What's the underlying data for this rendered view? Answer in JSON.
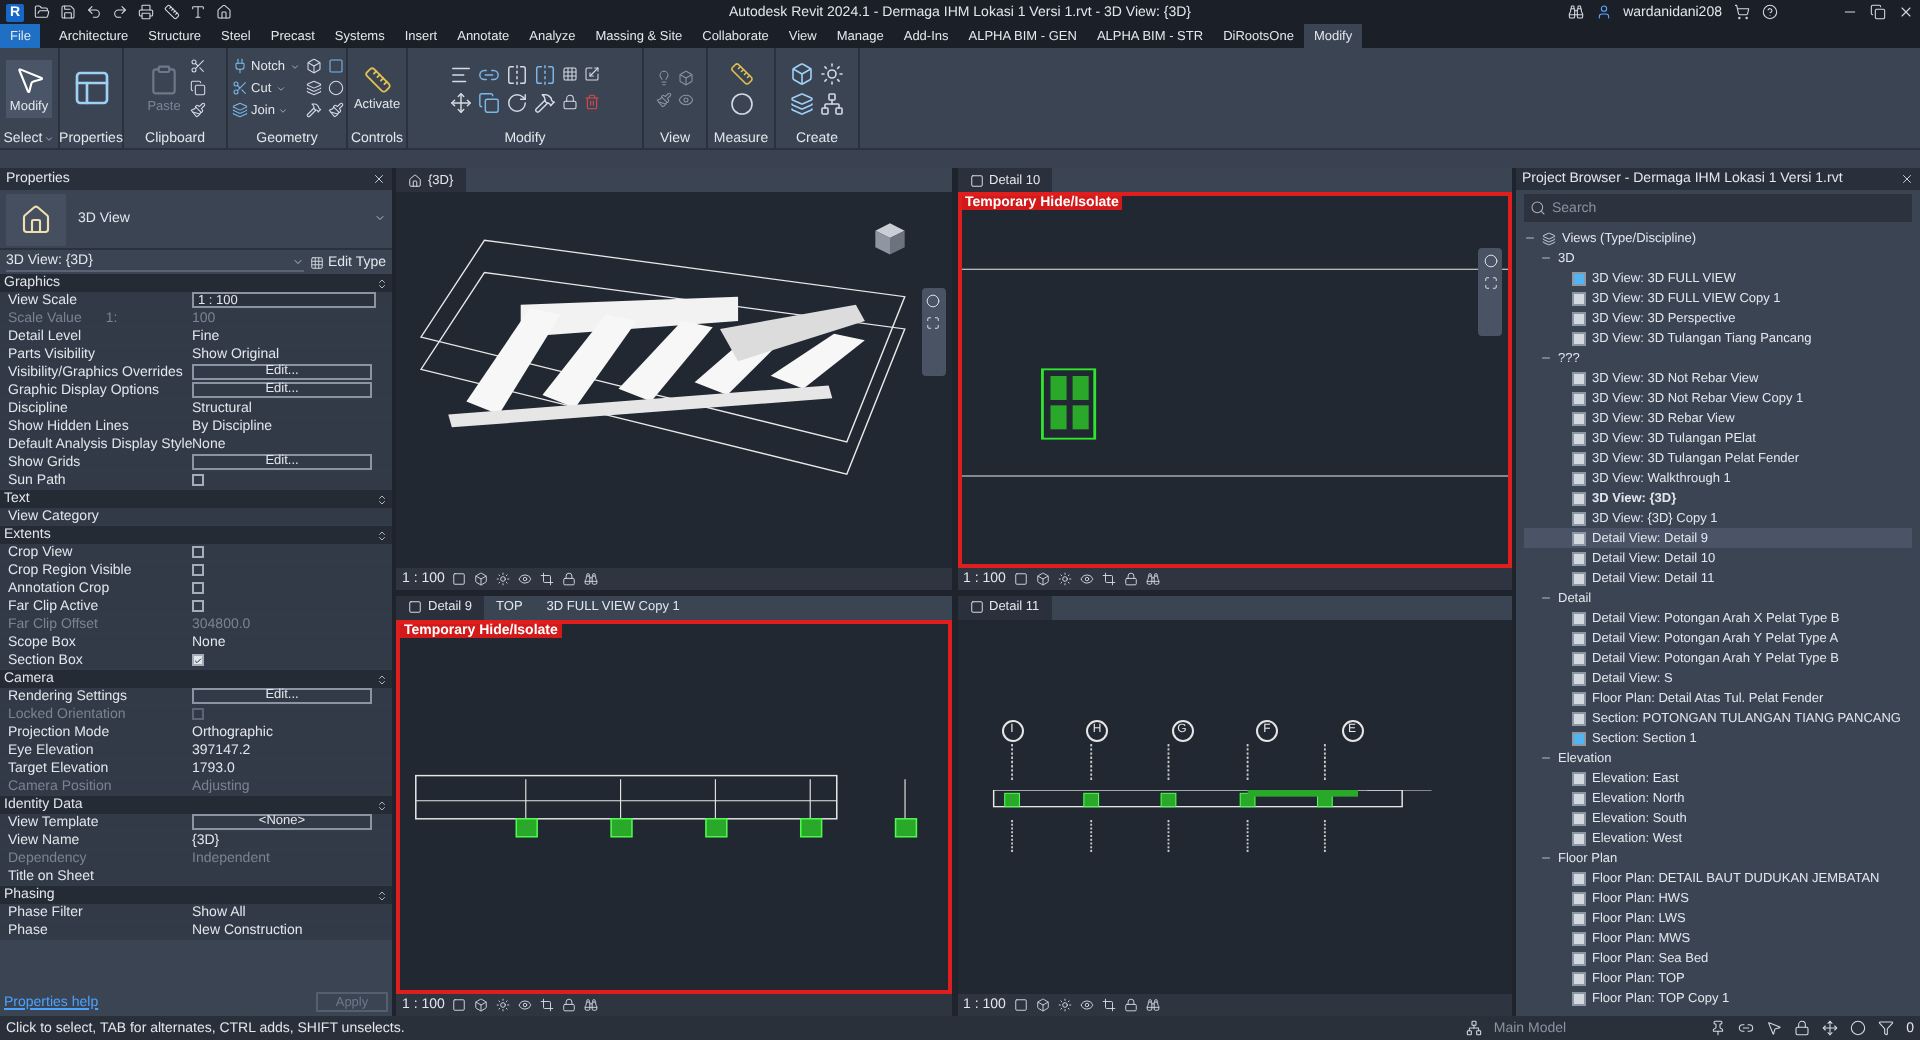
{
  "window": {
    "app_badge": "R",
    "title": "Autodesk Revit 2024.1 - Dermaga IHM Lokasi 1 Versi 1.rvt - 3D View: {3D}",
    "user": "wardanidani208"
  },
  "ribbon_tabs": [
    {
      "label": "File",
      "kind": "file",
      "selected": false
    },
    {
      "label": "Architecture",
      "kind": "tab",
      "selected": false
    },
    {
      "label": "Structure",
      "kind": "tab",
      "selected": false
    },
    {
      "label": "Steel",
      "kind": "tab",
      "selected": false
    },
    {
      "label": "Precast",
      "kind": "tab",
      "selected": false
    },
    {
      "label": "Systems",
      "kind": "tab",
      "selected": false
    },
    {
      "label": "Insert",
      "kind": "tab",
      "selected": false
    },
    {
      "label": "Annotate",
      "kind": "tab",
      "selected": false
    },
    {
      "label": "Analyze",
      "kind": "tab",
      "selected": false
    },
    {
      "label": "Massing & Site",
      "kind": "tab",
      "selected": false
    },
    {
      "label": "Collaborate",
      "kind": "tab",
      "selected": false
    },
    {
      "label": "View",
      "kind": "tab",
      "selected": false
    },
    {
      "label": "Manage",
      "kind": "tab",
      "selected": false
    },
    {
      "label": "Add-Ins",
      "kind": "tab",
      "selected": false
    },
    {
      "label": "ALPHA BIM - GEN",
      "kind": "tab",
      "selected": false
    },
    {
      "label": "ALPHA BIM - STR",
      "kind": "tab",
      "selected": false
    },
    {
      "label": "DiRootsOne",
      "kind": "tab",
      "selected": false
    },
    {
      "label": "Modify",
      "kind": "tab",
      "selected": true
    }
  ],
  "ribbon_panels": [
    {
      "kind": "select",
      "label": "Select",
      "tools": [
        {
          "label": "Modify",
          "disabled": false
        }
      ]
    },
    {
      "kind": "properties",
      "label": "Properties"
    },
    {
      "kind": "clipboard",
      "label": "Clipboard",
      "tools": [
        {
          "label": "Paste",
          "disabled": true
        }
      ]
    },
    {
      "kind": "geometry",
      "label": "Geometry",
      "tools": [
        {
          "label": "Notch",
          "disabled": false
        },
        {
          "label": "Cut",
          "disabled": false
        },
        {
          "label": "Join",
          "disabled": false
        }
      ]
    },
    {
      "kind": "controls",
      "label": "Controls",
      "tools": [
        {
          "label": "Activate",
          "disabled": false
        }
      ]
    },
    {
      "kind": "modify",
      "label": "Modify"
    },
    {
      "kind": "view",
      "label": "View"
    },
    {
      "kind": "measure",
      "label": "Measure"
    },
    {
      "kind": "create",
      "label": "Create"
    }
  ],
  "properties": {
    "title": "Properties",
    "type_name": "3D View",
    "view_selector": "3D View: {3D}",
    "edit_type": "Edit Type",
    "sections": [
      {
        "title": "Graphics",
        "rows": [
          {
            "label": "View Scale",
            "kind": "input",
            "value": "1 : 100",
            "disabled": false
          },
          {
            "label": "Scale Value",
            "unit": "1:",
            "kind": "text",
            "value": "100",
            "disabled": true
          },
          {
            "label": "Detail Level",
            "kind": "text",
            "value": "Fine",
            "disabled": false
          },
          {
            "label": "Parts Visibility",
            "kind": "text",
            "value": "Show Original",
            "disabled": false
          },
          {
            "label": "Visibility/Graphics Overrides",
            "kind": "button",
            "value": "Edit...",
            "disabled": false
          },
          {
            "label": "Graphic Display Options",
            "kind": "button",
            "value": "Edit...",
            "disabled": false
          },
          {
            "label": "Discipline",
            "kind": "text",
            "value": "Structural",
            "disabled": false
          },
          {
            "label": "Show Hidden Lines",
            "kind": "text",
            "value": "By Discipline",
            "disabled": false
          },
          {
            "label": "Default Analysis Display Style",
            "kind": "text",
            "value": "None",
            "disabled": false
          },
          {
            "label": "Show Grids",
            "kind": "button",
            "value": "Edit...",
            "disabled": false
          },
          {
            "label": "Sun Path",
            "kind": "checkbox",
            "checked": false,
            "disabled": false
          }
        ]
      },
      {
        "title": "Text",
        "rows": [
          {
            "label": "View Category",
            "kind": "blank",
            "disabled": false
          }
        ]
      },
      {
        "title": "Extents",
        "rows": [
          {
            "label": "Crop View",
            "kind": "checkbox",
            "checked": false,
            "disabled": false
          },
          {
            "label": "Crop Region Visible",
            "kind": "checkbox",
            "checked": false,
            "disabled": false
          },
          {
            "label": "Annotation Crop",
            "kind": "checkbox",
            "checked": false,
            "disabled": false
          },
          {
            "label": "Far Clip Active",
            "kind": "checkbox",
            "checked": false,
            "disabled": false
          },
          {
            "label": "Far Clip Offset",
            "kind": "text",
            "value": "304800.0",
            "disabled": true
          },
          {
            "label": "Scope Box",
            "kind": "text",
            "value": "None",
            "disabled": false
          },
          {
            "label": "Section Box",
            "kind": "checkbox",
            "checked": true,
            "disabled": false
          }
        ]
      },
      {
        "title": "Camera",
        "rows": [
          {
            "label": "Rendering Settings",
            "kind": "button",
            "value": "Edit...",
            "disabled": false
          },
          {
            "label": "Locked Orientation",
            "kind": "checkbox",
            "checked": false,
            "disabled": true
          },
          {
            "label": "Projection Mode",
            "kind": "text",
            "value": "Orthographic",
            "disabled": false
          },
          {
            "label": "Eye Elevation",
            "kind": "text",
            "value": "397147.2",
            "disabled": false
          },
          {
            "label": "Target Elevation",
            "kind": "text",
            "value": "1793.0",
            "disabled": false
          },
          {
            "label": "Camera Position",
            "kind": "text",
            "value": "Adjusting",
            "disabled": true
          }
        ]
      },
      {
        "title": "Identity Data",
        "rows": [
          {
            "label": "View Template",
            "kind": "button",
            "value": "<None>",
            "disabled": false
          },
          {
            "label": "View Name",
            "kind": "text",
            "value": "{3D}",
            "disabled": false
          },
          {
            "label": "Dependency",
            "kind": "text",
            "value": "Independent",
            "disabled": true
          },
          {
            "label": "Title on Sheet",
            "kind": "blank",
            "disabled": false
          }
        ]
      },
      {
        "title": "Phasing",
        "rows": [
          {
            "label": "Phase Filter",
            "kind": "text",
            "value": "Show All",
            "disabled": false
          },
          {
            "label": "Phase",
            "kind": "text",
            "value": "New Construction",
            "disabled": false
          }
        ]
      }
    ],
    "help_link": "Properties help",
    "apply": {
      "label": "Apply",
      "disabled": true
    }
  },
  "viewports": [
    {
      "kind": "model",
      "tabs": [
        {
          "label": "{3D}",
          "selected": true
        }
      ],
      "scale": "1 : 100"
    },
    {
      "kind": "plan",
      "tabs": [
        {
          "label": "Detail 10",
          "selected": true
        }
      ],
      "scale": "1 : 100",
      "isolate_label": "Temporary Hide/Isolate"
    },
    {
      "kind": "section",
      "tabs": [
        {
          "label": "Detail 9",
          "selected": true
        },
        {
          "label": "TOP",
          "selected": false
        },
        {
          "label": "3D FULL VIEW Copy 1",
          "selected": false
        }
      ],
      "scale": "1 : 100",
      "isolate_label": "Temporary Hide/Isolate"
    },
    {
      "kind": "gridline",
      "tabs": [
        {
          "label": "Detail 11",
          "selected": true
        }
      ],
      "scale": "1 : 100",
      "grid_labels": [
        "I",
        "H",
        "G",
        "F",
        "E"
      ]
    }
  ],
  "project_browser": {
    "title": "Project Browser - Dermaga IHM Lokasi 1 Versi 1.rvt",
    "search_placeholder": "Search",
    "tree": [
      {
        "label": "Views (Type/Discipline)",
        "expanded": true,
        "children": [
          {
            "label": "3D",
            "expanded": true,
            "children": [
              {
                "label": "3D View: 3D FULL VIEW",
                "selected": false,
                "open": true,
                "active": false
              },
              {
                "label": "3D View: 3D FULL VIEW Copy 1",
                "selected": false,
                "open": false,
                "active": false
              },
              {
                "label": "3D View: 3D Perspective",
                "selected": false,
                "open": false,
                "active": false
              },
              {
                "label": "3D View: 3D Tulangan Tiang Pancang",
                "selected": false,
                "open": false,
                "active": false
              }
            ]
          },
          {
            "label": "???",
            "expanded": true,
            "children": [
              {
                "label": "3D View: 3D Not Rebar View",
                "selected": false,
                "open": false,
                "active": false
              },
              {
                "label": "3D View: 3D Not Rebar View Copy 1",
                "selected": false,
                "open": false,
                "active": false
              },
              {
                "label": "3D View: 3D Rebar View",
                "selected": false,
                "open": false,
                "active": false
              },
              {
                "label": "3D View: 3D Tulangan PElat",
                "selected": false,
                "open": false,
                "active": false
              },
              {
                "label": "3D View: 3D Tulangan Pelat Fender",
                "selected": false,
                "open": false,
                "active": false
              },
              {
                "label": "3D View: Walkthrough 1",
                "selected": false,
                "open": false,
                "active": false
              },
              {
                "label": "3D View: {3D}",
                "selected": false,
                "open": false,
                "active": true
              },
              {
                "label": "3D View: {3D} Copy 1",
                "selected": false,
                "open": false,
                "active": false
              },
              {
                "label": "Detail View: Detail 9",
                "selected": true,
                "open": false,
                "active": false
              },
              {
                "label": "Detail View: Detail 10",
                "selected": false,
                "open": false,
                "active": false
              },
              {
                "label": "Detail View: Detail 11",
                "selected": false,
                "open": false,
                "active": false
              }
            ]
          },
          {
            "label": "Detail",
            "expanded": true,
            "children": [
              {
                "label": "Detail View: Potongan Arah X Pelat Type B",
                "selected": false,
                "open": false,
                "active": false
              },
              {
                "label": "Detail View: Potongan Arah Y Pelat Type A",
                "selected": false,
                "open": false,
                "active": false
              },
              {
                "label": "Detail View: Potongan Arah Y Pelat Type B",
                "selected": false,
                "open": false,
                "active": false
              },
              {
                "label": "Detail View: S",
                "selected": false,
                "open": false,
                "active": false
              },
              {
                "label": "Floor Plan: Detail Atas Tul. Pelat Fender",
                "selected": false,
                "open": false,
                "active": false
              },
              {
                "label": "Section: POTONGAN TULANGAN TIANG PANCANG",
                "selected": false,
                "open": false,
                "active": false
              },
              {
                "label": "Section: Section 1",
                "selected": false,
                "open": true,
                "active": false
              }
            ]
          },
          {
            "label": "Elevation",
            "expanded": true,
            "children": [
              {
                "label": "Elevation: East",
                "selected": false,
                "open": false,
                "active": false
              },
              {
                "label": "Elevation: North",
                "selected": false,
                "open": false,
                "active": false
              },
              {
                "label": "Elevation: South",
                "selected": false,
                "open": false,
                "active": false
              },
              {
                "label": "Elevation: West",
                "selected": false,
                "open": false,
                "active": false
              }
            ]
          },
          {
            "label": "Floor Plan",
            "expanded": true,
            "children": [
              {
                "label": "Floor Plan: DETAIL BAUT DUDUKAN JEMBATAN",
                "selected": false,
                "open": false,
                "active": false
              },
              {
                "label": "Floor Plan: HWS",
                "selected": false,
                "open": false,
                "active": false
              },
              {
                "label": "Floor Plan: LWS",
                "selected": false,
                "open": false,
                "active": false
              },
              {
                "label": "Floor Plan: MWS",
                "selected": false,
                "open": false,
                "active": false
              },
              {
                "label": "Floor Plan: Sea Bed",
                "selected": false,
                "open": false,
                "active": false
              },
              {
                "label": "Floor Plan: TOP",
                "selected": false,
                "open": false,
                "active": false
              },
              {
                "label": "Floor Plan: TOP Copy 1",
                "selected": false,
                "open": false,
                "active": false
              }
            ]
          }
        ]
      }
    ]
  },
  "status_bar": {
    "message": "Click to select, TAB for alternates, CTRL adds, SHIFT unselects.",
    "model": "Main Model",
    "selection_count": "0"
  }
}
